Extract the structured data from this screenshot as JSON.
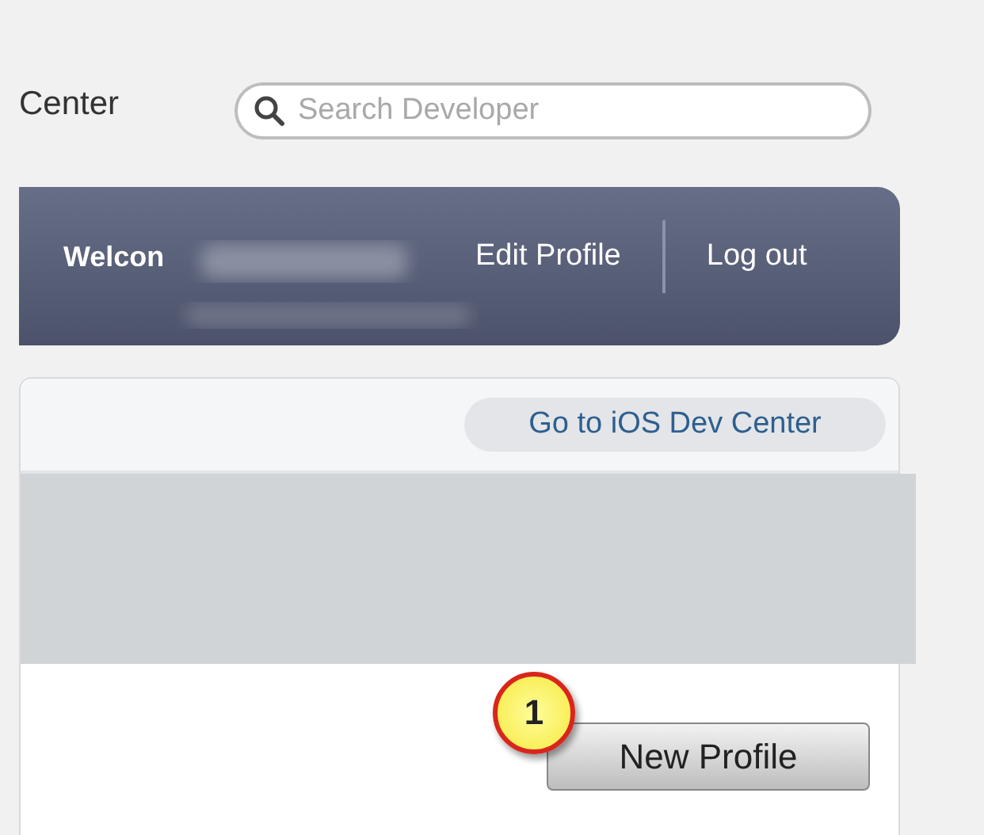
{
  "header": {
    "title": "Center",
    "search": {
      "placeholder": "Search Developer"
    }
  },
  "nav": {
    "welcome": "Welcon",
    "links": [
      "Edit Profile",
      "Log out"
    ]
  },
  "panel": {
    "dev_center_button": "Go to iOS Dev Center",
    "callout": "1",
    "new_profile_button": "New Profile"
  }
}
